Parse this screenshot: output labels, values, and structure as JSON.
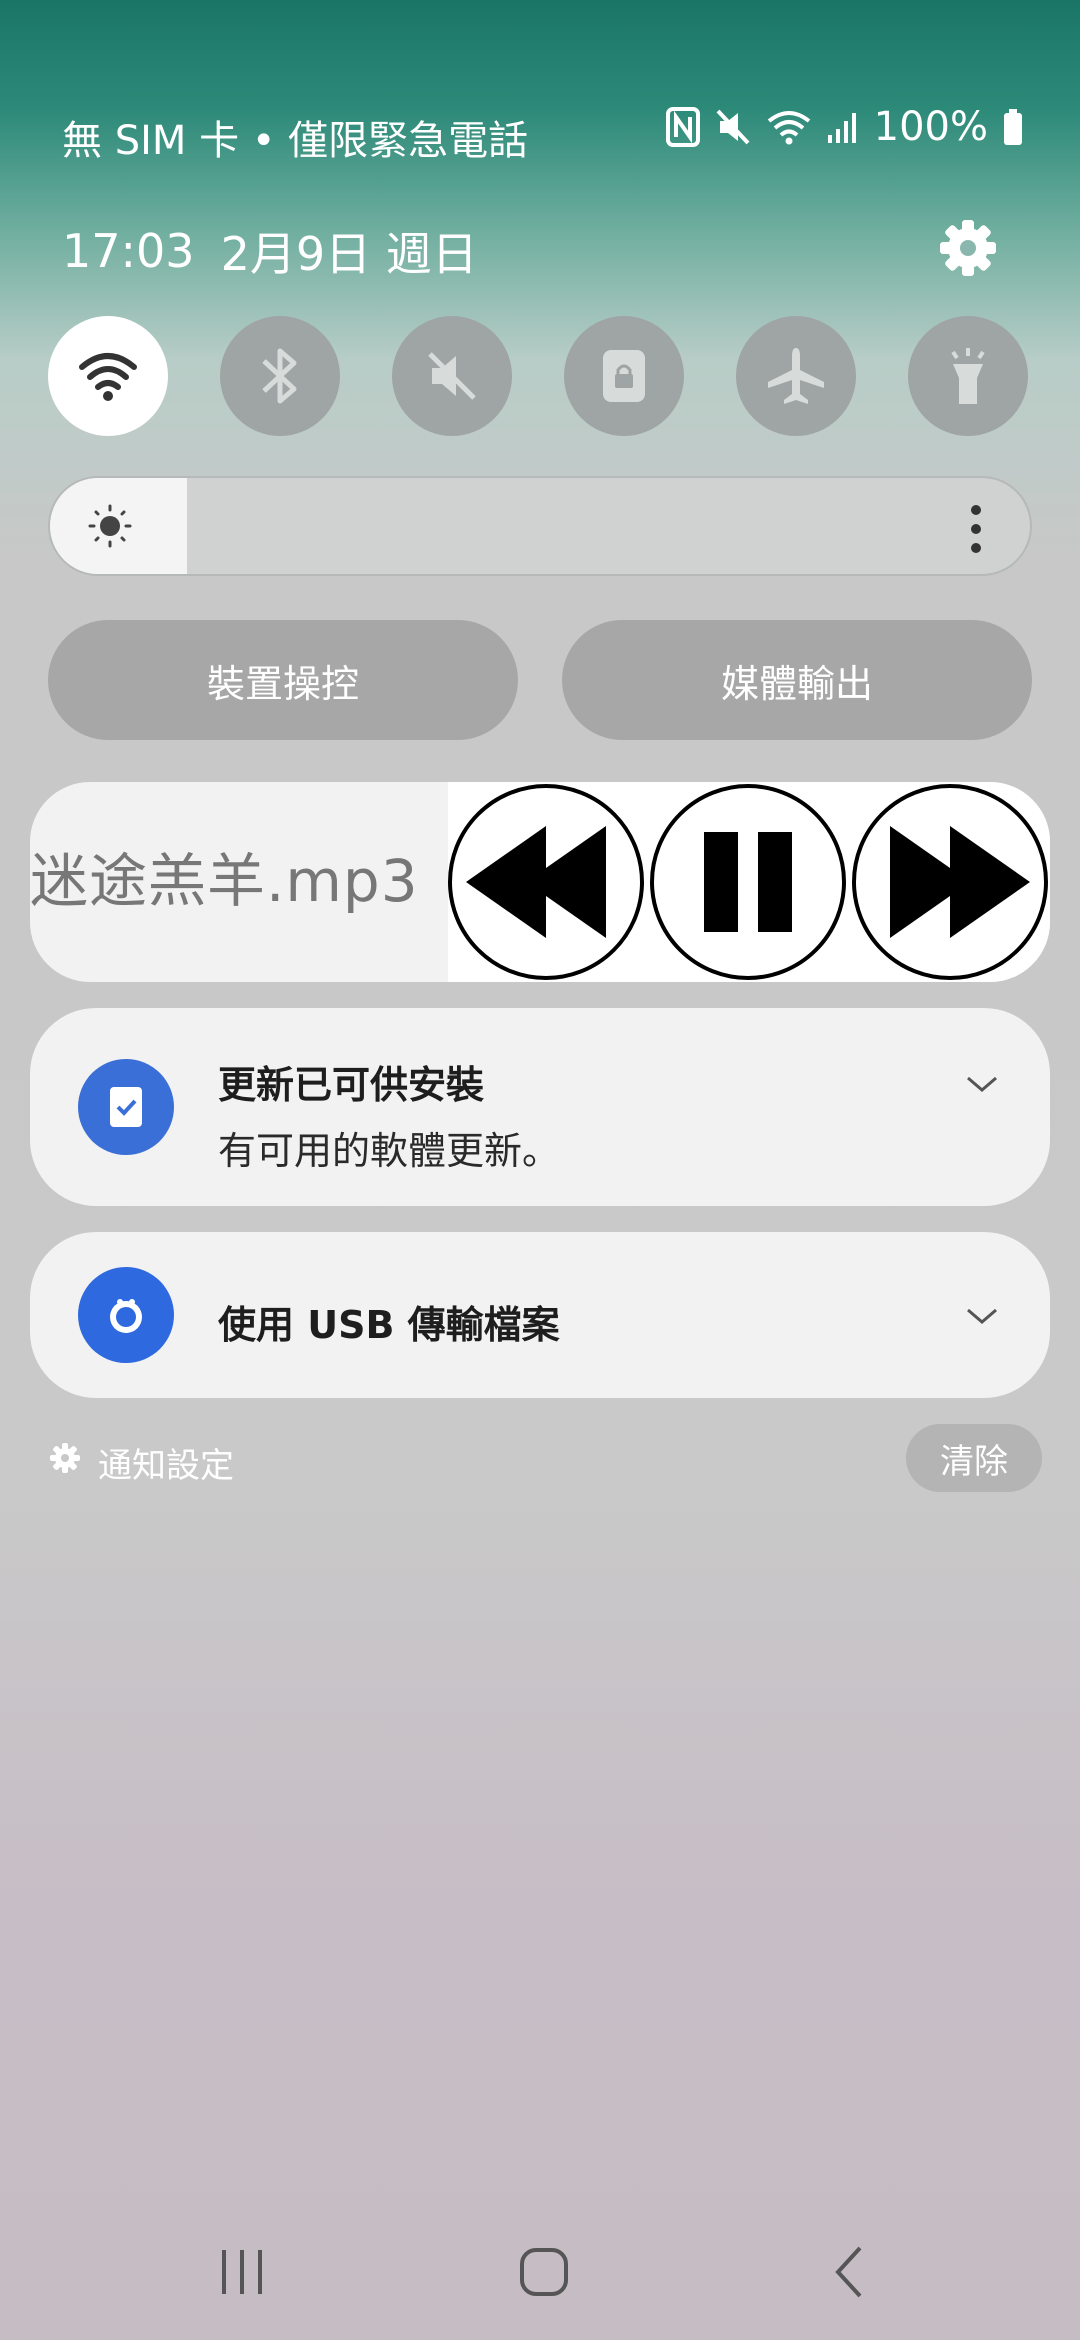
{
  "status_bar": {
    "carrier_text": "無 SIM 卡 • 僅限緊急電話",
    "battery_percent": "100%",
    "icons": [
      "nfc-icon",
      "mute-icon",
      "wifi-icon",
      "signal-icon",
      "battery-icon"
    ]
  },
  "header": {
    "time": "17:03",
    "date": "2月9日 週日",
    "settings_icon": "gear-icon"
  },
  "quick_toggles": [
    {
      "icon": "wifi-icon",
      "active": true
    },
    {
      "icon": "bluetooth-icon",
      "active": false
    },
    {
      "icon": "sound-off-icon",
      "active": false
    },
    {
      "icon": "rotation-lock-icon",
      "active": false
    },
    {
      "icon": "airplane-icon",
      "active": false
    },
    {
      "icon": "flashlight-icon",
      "active": false
    }
  ],
  "brightness": {
    "level": 0.14,
    "icon": "sun-icon",
    "more_icon": "more-vertical-icon"
  },
  "actions": {
    "device_control": "裝置操控",
    "media_output": "媒體輸出"
  },
  "media": {
    "title": "迷途羔羊.mp3",
    "controls": [
      "rewind-icon",
      "pause-icon",
      "fast-forward-icon"
    ]
  },
  "notifications": [
    {
      "title": "更新已可供安裝",
      "body": "有可用的軟體更新。",
      "icon": "update-icon",
      "color": "#3b6fd8"
    },
    {
      "title": "使用 USB 傳輸檔案",
      "body": "",
      "icon": "usb-icon",
      "color": "#2f69e0"
    }
  ],
  "footer": {
    "settings_label": "通知設定",
    "clear_label": "清除"
  },
  "nav": [
    "recent-apps-icon",
    "home-icon",
    "back-icon"
  ]
}
